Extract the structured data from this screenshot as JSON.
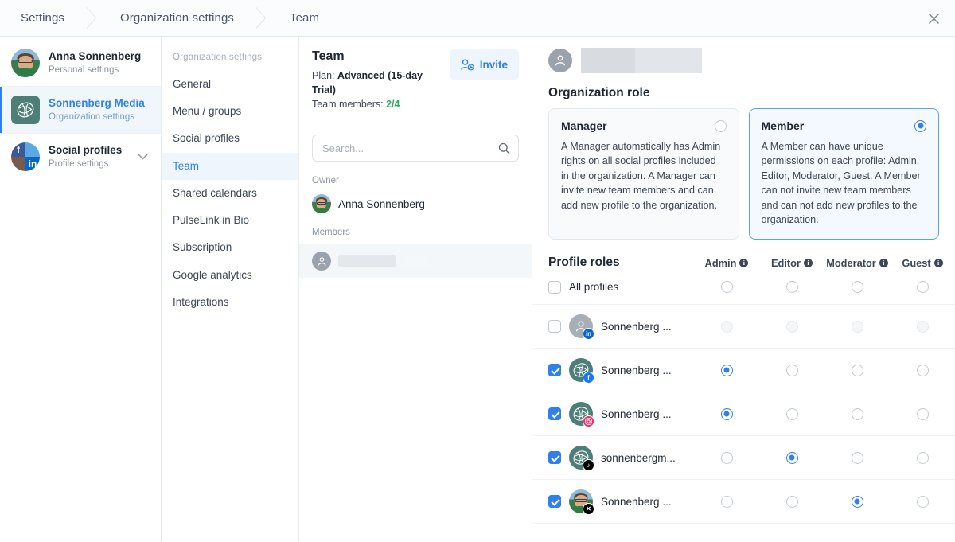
{
  "breadcrumb": {
    "items": [
      "Settings",
      "Organization settings",
      "Team"
    ]
  },
  "topbar": {
    "close_icon": "close-icon"
  },
  "accounts": [
    {
      "name": "Anna Sonnenberg",
      "sub": "Personal settings",
      "avatar": "photo-avatar",
      "selected": false,
      "caret": false
    },
    {
      "name": "Sonnenberg Media",
      "sub": "Organization settings",
      "avatar": "org-logo-avatar",
      "selected": true,
      "caret": false
    },
    {
      "name": "Social profiles",
      "sub": "Profile settings",
      "avatar": "social-quad-avatar",
      "selected": false,
      "caret": true
    }
  ],
  "nav": {
    "title": "Organization settings",
    "items": [
      {
        "label": "General",
        "selected": false
      },
      {
        "label": "Menu / groups",
        "selected": false
      },
      {
        "label": "Social profiles",
        "selected": false
      },
      {
        "label": "Team",
        "selected": true
      },
      {
        "label": "Shared calendars",
        "selected": false
      },
      {
        "label": "PulseLink in Bio",
        "selected": false
      },
      {
        "label": "Subscription",
        "selected": false
      },
      {
        "label": "Google analytics",
        "selected": false
      },
      {
        "label": "Integrations",
        "selected": false
      }
    ]
  },
  "team": {
    "title": "Team",
    "plan_label": "Plan:",
    "plan_value": "Advanced (15-day Trial)",
    "members_label": "Team members:",
    "members_used": "2",
    "members_total": "/4",
    "invite_label": "Invite",
    "invite_icon": "add-user-icon",
    "search_placeholder": "Search...",
    "search_value": "",
    "search_icon": "search-icon",
    "owner_label": "Owner",
    "owner_name": "Anna Sonnenberg",
    "members_section_label": "Members",
    "member_redacted": ""
  },
  "detail": {
    "member_name_redacted": "",
    "avatar_icon": "person-icon",
    "org_role_title": "Organization role",
    "roles": [
      {
        "name": "Manager",
        "selected": false,
        "description": "A Manager automatically has Admin rights on all social profiles included in the organization. A Manager can invite new team members and can add new profile to the organization."
      },
      {
        "name": "Member",
        "selected": true,
        "description": "A Member can have unique permissions on each profile: Admin, Editor, Moderator, Guest. A Member can not invite new team members and can not add new profiles to the organization."
      }
    ],
    "profile_roles": {
      "title": "Profile roles",
      "columns": [
        "Admin",
        "Editor",
        "Moderator",
        "Guest"
      ],
      "all_row": {
        "label": "All profiles",
        "checked": false,
        "selected_role": null
      },
      "rows": [
        {
          "label": "Sonnenberg ...",
          "network": "linkedin",
          "avatar": "anon",
          "checked": false,
          "disabled": true,
          "selected_role": null
        },
        {
          "label": "Sonnenberg ...",
          "network": "facebook",
          "avatar": "org",
          "checked": true,
          "disabled": false,
          "selected_role": "Admin"
        },
        {
          "label": "Sonnenberg ...",
          "network": "instagram",
          "avatar": "org",
          "checked": true,
          "disabled": false,
          "selected_role": "Admin"
        },
        {
          "label": "sonnenbergm...",
          "network": "tiktok",
          "avatar": "org",
          "checked": true,
          "disabled": false,
          "selected_role": "Editor"
        },
        {
          "label": "Sonnenberg ...",
          "network": "x",
          "avatar": "photo",
          "checked": true,
          "disabled": false,
          "selected_role": "Moderator"
        }
      ]
    }
  },
  "colors": {
    "accent": "#2f80ed",
    "accent_soft": "#eef5fc",
    "green": "#27ae60",
    "org_teal": "#4d7f78",
    "border": "#e8ecf0"
  }
}
